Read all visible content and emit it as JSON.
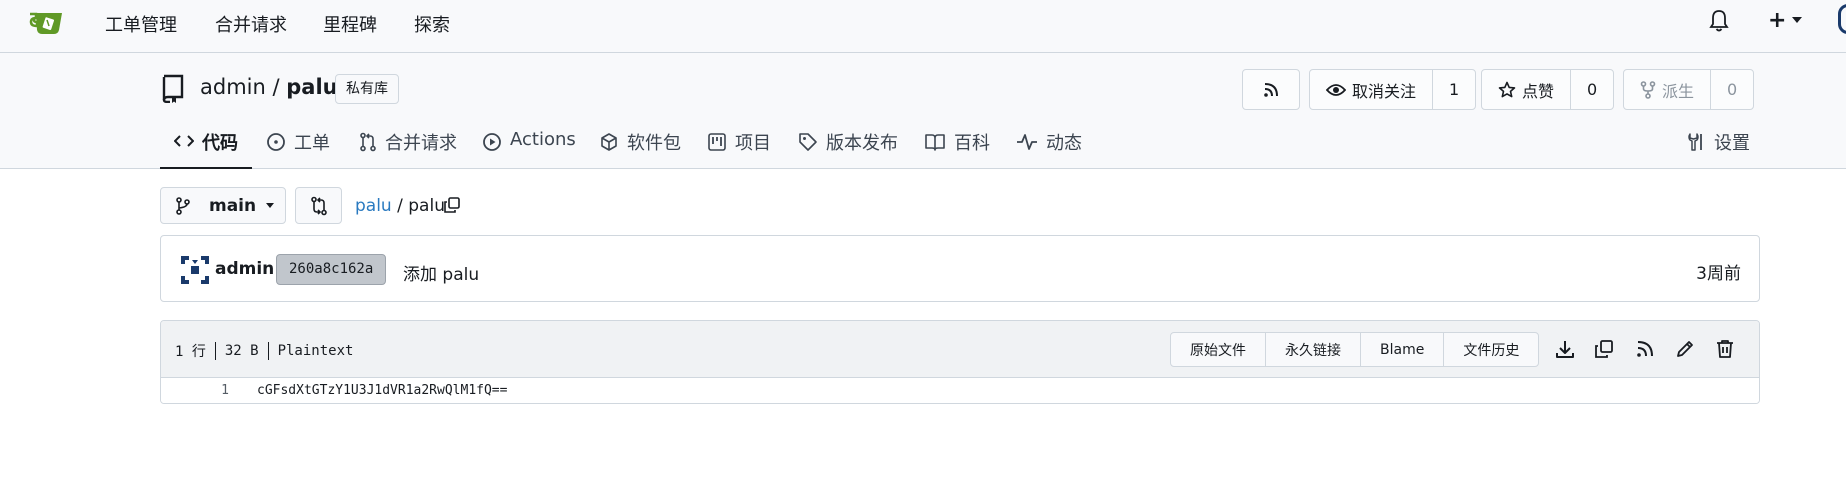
{
  "topnav": {
    "items": [
      "工单管理",
      "合并请求",
      "里程碑",
      "探索"
    ],
    "create_label": "+"
  },
  "repo": {
    "owner": "admin",
    "separator": "/",
    "name": "palu",
    "badge": "私有库",
    "unwatch_label": "取消关注",
    "watch_count": "1",
    "star_label": "点赞",
    "star_count": "0",
    "fork_label": "派生",
    "fork_count": "0"
  },
  "tabs": [
    "代码",
    "工单",
    "合并请求",
    "Actions",
    "软件包",
    "项目",
    "版本发布",
    "百科",
    "动态"
  ],
  "settings_label": "设置",
  "breadcrumb": {
    "branch": "main",
    "repo_link": "palu",
    "separator": "/",
    "file": "palu"
  },
  "commit": {
    "author": "admin",
    "sha": "260a8c162a",
    "message": "添加 palu",
    "time": "3周前"
  },
  "file": {
    "lines": "1 行",
    "size": "32 B",
    "type": "Plaintext",
    "actions": [
      "原始文件",
      "永久链接",
      "Blame",
      "文件历史"
    ],
    "icons": [
      "download-icon",
      "copy-icon",
      "rss-icon",
      "edit-icon",
      "trash-icon"
    ],
    "line_number": "1",
    "content": "cGFsdXtGTzY1U3J1dVR1a2RwQlM1fQ=="
  },
  "colors": {
    "accent_link": "#2a7ac0",
    "logo_green": "#609926",
    "header_bg": "#f8f9fb"
  }
}
